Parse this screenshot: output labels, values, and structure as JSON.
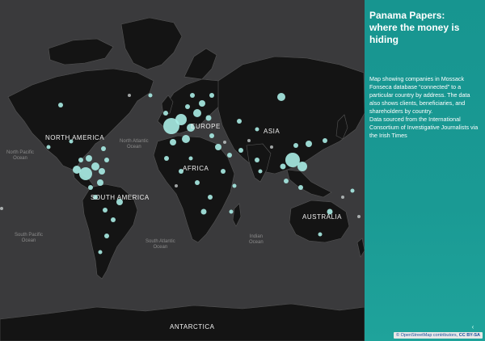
{
  "panel": {
    "title_line1": "Panama Papers:",
    "title_line2": "where the money is hiding",
    "desc_line1": "Map showing companies in Mossack Fonseca database “connected” to a particular country by address. The data also shows clients, beneficiaries, and shareholders by country.",
    "desc_line2": "Data sourced from the International Consortium of Investigative Journalists via the Irish Times"
  },
  "map": {
    "continents": {
      "north_america": "NORTH AMERICA",
      "south_america": "SOUTH AMERICA",
      "europe": "EUROPE",
      "asia": "ASIA",
      "africa": "AFRICA",
      "australia": "AUSTRALIA",
      "antarctica": "ANTARCTICA"
    },
    "oceans": {
      "north_atlantic_1": "North Atlantic",
      "north_atlantic_2": "Ocean",
      "north_pacific_1": "North Pacific",
      "north_pacific_2": "Ocean",
      "south_pacific_1": "South Pacific",
      "south_pacific_2": "Ocean",
      "south_atlantic_1": "South Atlantic",
      "south_atlantic_2": "Ocean",
      "indian_1": "Indian",
      "indian_2": "Ocean"
    },
    "point_color": "#a8ece4",
    "land_color": "#141414",
    "ocean_color": "#3a3a3c"
  },
  "attribution": {
    "text": "© OpenStreetMap contributors,",
    "license": "CC BY-SA"
  },
  "colors": {
    "panel_bg": "#179590",
    "panel_text": "#ffffff"
  }
}
